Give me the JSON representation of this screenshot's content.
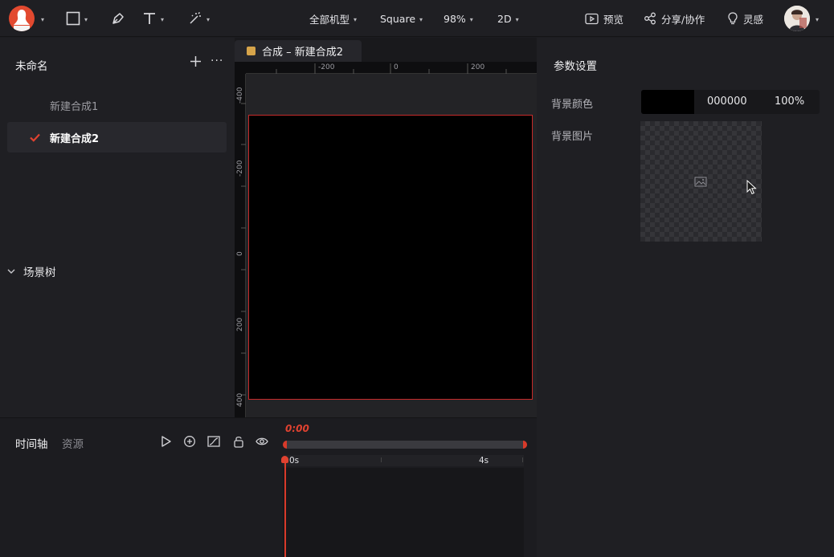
{
  "toolbar": {
    "device": "全部机型",
    "preset": "Square",
    "zoom": "98%",
    "mode": "2D",
    "preview": "预览",
    "share": "分享/协作",
    "inspiration": "灵感"
  },
  "left_panel": {
    "project_name": "未命名",
    "compositions": [
      {
        "label": "新建合成1",
        "active": false
      },
      {
        "label": "新建合成2",
        "active": true
      }
    ],
    "scene_tree": "场景树"
  },
  "canvas": {
    "tab_title": "合成 – 新建合成2",
    "ruler_h_labels": [
      "-200",
      "0",
      "200"
    ],
    "ruler_v_labels": [
      "-400",
      "-200",
      "0",
      "200",
      "400"
    ]
  },
  "right_panel": {
    "title": "参数设置",
    "bg_color_label": "背景颜色",
    "bg_color_hex": "000000",
    "bg_color_opacity": "100%",
    "bg_image_label": "背景图片",
    "swatch_color": "#000000"
  },
  "timeline": {
    "tabs": [
      "时间轴",
      "资源"
    ],
    "current_time": "0:00",
    "ruler_labels": [
      "0s",
      "4s"
    ]
  },
  "colors": {
    "accent": "#e04230",
    "comp_tag": "#d6a44a"
  }
}
